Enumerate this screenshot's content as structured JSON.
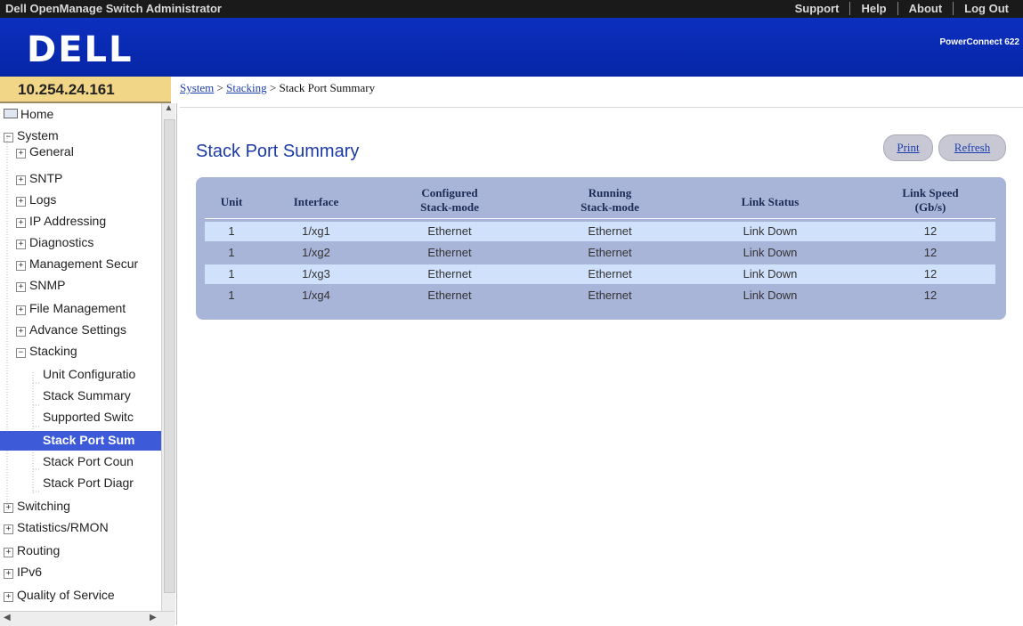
{
  "topbar": {
    "title": "Dell OpenManage Switch Administrator",
    "links": [
      "Support",
      "Help",
      "About",
      "Log Out"
    ]
  },
  "header": {
    "logo": "DELL",
    "model": "PowerConnect 622"
  },
  "ip": "10.254.24.161",
  "breadcrumb": {
    "items": [
      "System",
      "Stacking",
      "Stack Port Summary"
    ],
    "sep": " > "
  },
  "sidebar": {
    "items": [
      {
        "label": "Home",
        "toggle": "",
        "icon": "home-icon"
      },
      {
        "label": "System",
        "toggle": "−"
      },
      {
        "label": "General",
        "toggle": "+"
      },
      {
        "label": "SNTP",
        "toggle": "+"
      },
      {
        "label": "Logs",
        "toggle": "+"
      },
      {
        "label": "IP Addressing",
        "toggle": "+"
      },
      {
        "label": "Diagnostics",
        "toggle": "+"
      },
      {
        "label": "Management Secur",
        "toggle": "+"
      },
      {
        "label": "SNMP",
        "toggle": "+"
      },
      {
        "label": "File Management",
        "toggle": "+"
      },
      {
        "label": "Advance Settings",
        "toggle": "+"
      },
      {
        "label": "Stacking",
        "toggle": "−"
      },
      {
        "label": "Unit Configuratio"
      },
      {
        "label": "Stack Summary"
      },
      {
        "label": "Supported Switc"
      },
      {
        "label": "Stack Port Sum",
        "selected": true
      },
      {
        "label": "Stack Port Coun"
      },
      {
        "label": "Stack Port Diagr"
      },
      {
        "label": "Switching",
        "toggle": "+"
      },
      {
        "label": "Statistics/RMON",
        "toggle": "+"
      },
      {
        "label": "Routing",
        "toggle": "+"
      },
      {
        "label": "IPv6",
        "toggle": "+"
      },
      {
        "label": "Quality of Service",
        "toggle": "+"
      }
    ]
  },
  "main": {
    "title": "Stack Port Summary",
    "print_label": "Print",
    "refresh_label": "Refresh",
    "table": {
      "headers": [
        [
          "Unit"
        ],
        [
          "Interface"
        ],
        [
          "Configured",
          "Stack-mode"
        ],
        [
          "Running",
          "Stack-mode"
        ],
        [
          "Link Status"
        ],
        [
          "Link Speed",
          "(Gb/s)"
        ]
      ],
      "rows": [
        [
          "1",
          "1/xg1",
          "Ethernet",
          "Ethernet",
          "Link Down",
          "12"
        ],
        [
          "1",
          "1/xg2",
          "Ethernet",
          "Ethernet",
          "Link Down",
          "12"
        ],
        [
          "1",
          "1/xg3",
          "Ethernet",
          "Ethernet",
          "Link Down",
          "12"
        ],
        [
          "1",
          "1/xg4",
          "Ethernet",
          "Ethernet",
          "Link Down",
          "12"
        ]
      ]
    }
  },
  "colors": {
    "header_blue": "#0a2ab0",
    "ip_bar": "#f2d688",
    "table_panel": "#a8b4d8",
    "row_highlight": "#cfe1fb",
    "selected": "#3d5ad8"
  }
}
